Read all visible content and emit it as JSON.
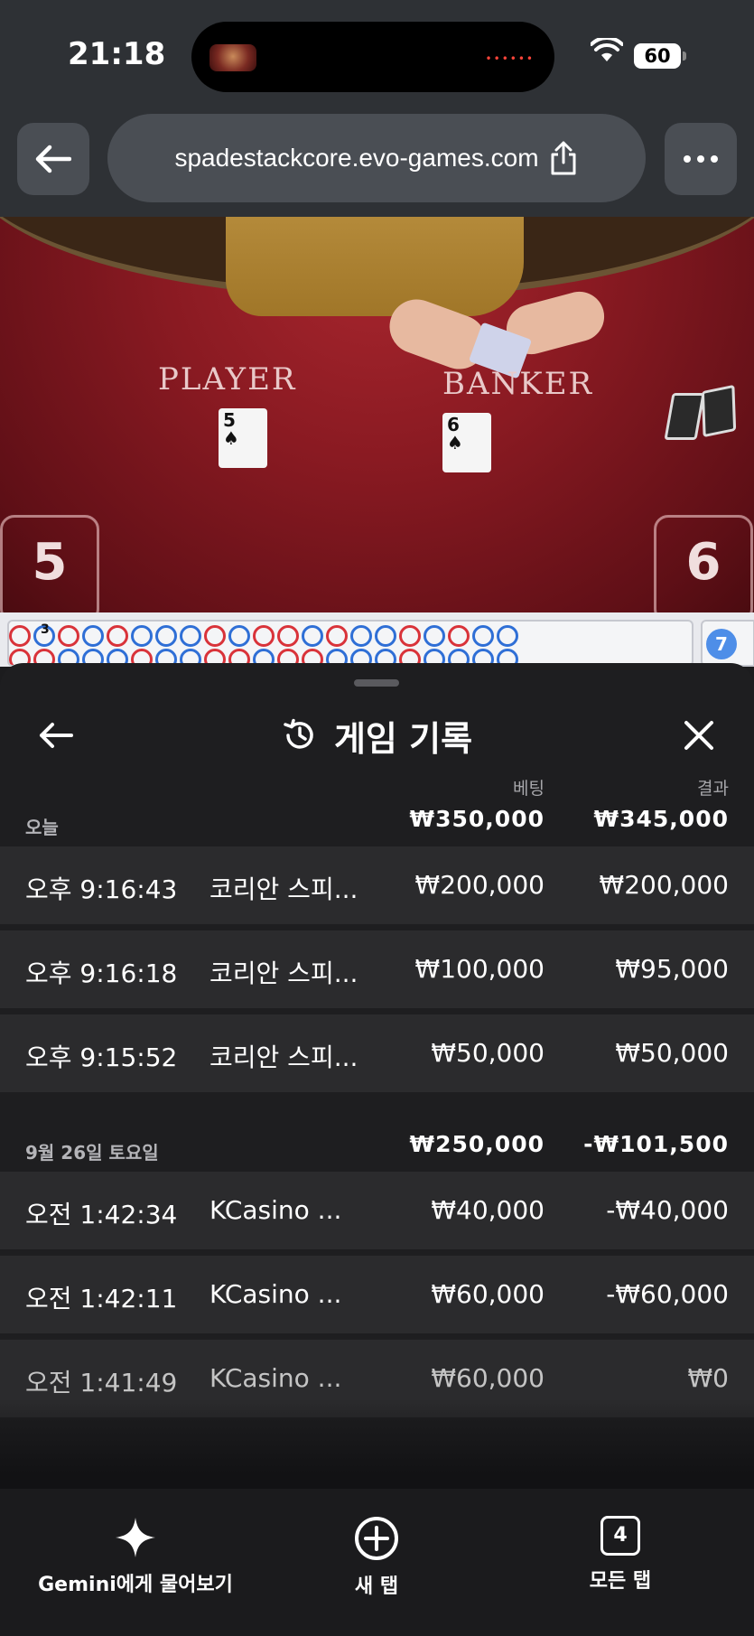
{
  "status_bar": {
    "time": "21:18",
    "battery": "60"
  },
  "browser": {
    "url": "spadestackcore.evo-games.com",
    "back_icon": "arrow-left-icon",
    "share_icon": "share-icon",
    "menu_icon": "more-dots-icon"
  },
  "game": {
    "player_label": "PLAYER",
    "banker_label": "BANKER",
    "player_card": {
      "rank": "5",
      "suit": "♠"
    },
    "banker_card": {
      "rank": "6",
      "suit": "♠"
    },
    "player_score": "5",
    "banker_score": "6",
    "roadmap_first_badge": "3",
    "roadmap_side_badge": "7"
  },
  "history": {
    "title": "게임 기록",
    "title_icon": "history-icon",
    "col_bet": "베팅",
    "col_result": "결과",
    "groups": [
      {
        "label": "오늘",
        "bet_total": "₩350,000",
        "result_total": "₩345,000",
        "rows": [
          {
            "time": "오후 9:16:43",
            "game": "코리안 스피...",
            "bet": "₩200,000",
            "result": "₩200,000"
          },
          {
            "time": "오후 9:16:18",
            "game": "코리안 스피...",
            "bet": "₩100,000",
            "result": "₩95,000"
          },
          {
            "time": "오후 9:15:52",
            "game": "코리안 스피...",
            "bet": "₩50,000",
            "result": "₩50,000"
          }
        ]
      },
      {
        "label": "9월 26일 토요일",
        "bet_total": "₩250,000",
        "result_total": "-₩101,500",
        "rows": [
          {
            "time": "오전 1:42:34",
            "game": "KCasino ...",
            "bet": "₩40,000",
            "result": "-₩40,000"
          },
          {
            "time": "오전 1:42:11",
            "game": "KCasino ...",
            "bet": "₩60,000",
            "result": "-₩60,000"
          },
          {
            "time": "오전 1:41:49",
            "game": "KCasino ...",
            "bet": "₩60,000",
            "result": "₩0"
          }
        ]
      }
    ]
  },
  "bottom_bar": {
    "gemini_label": "Gemini에게 물어보기",
    "new_tab_label": "새 탭",
    "all_tabs_label": "모든 탭",
    "tab_count": "4"
  }
}
